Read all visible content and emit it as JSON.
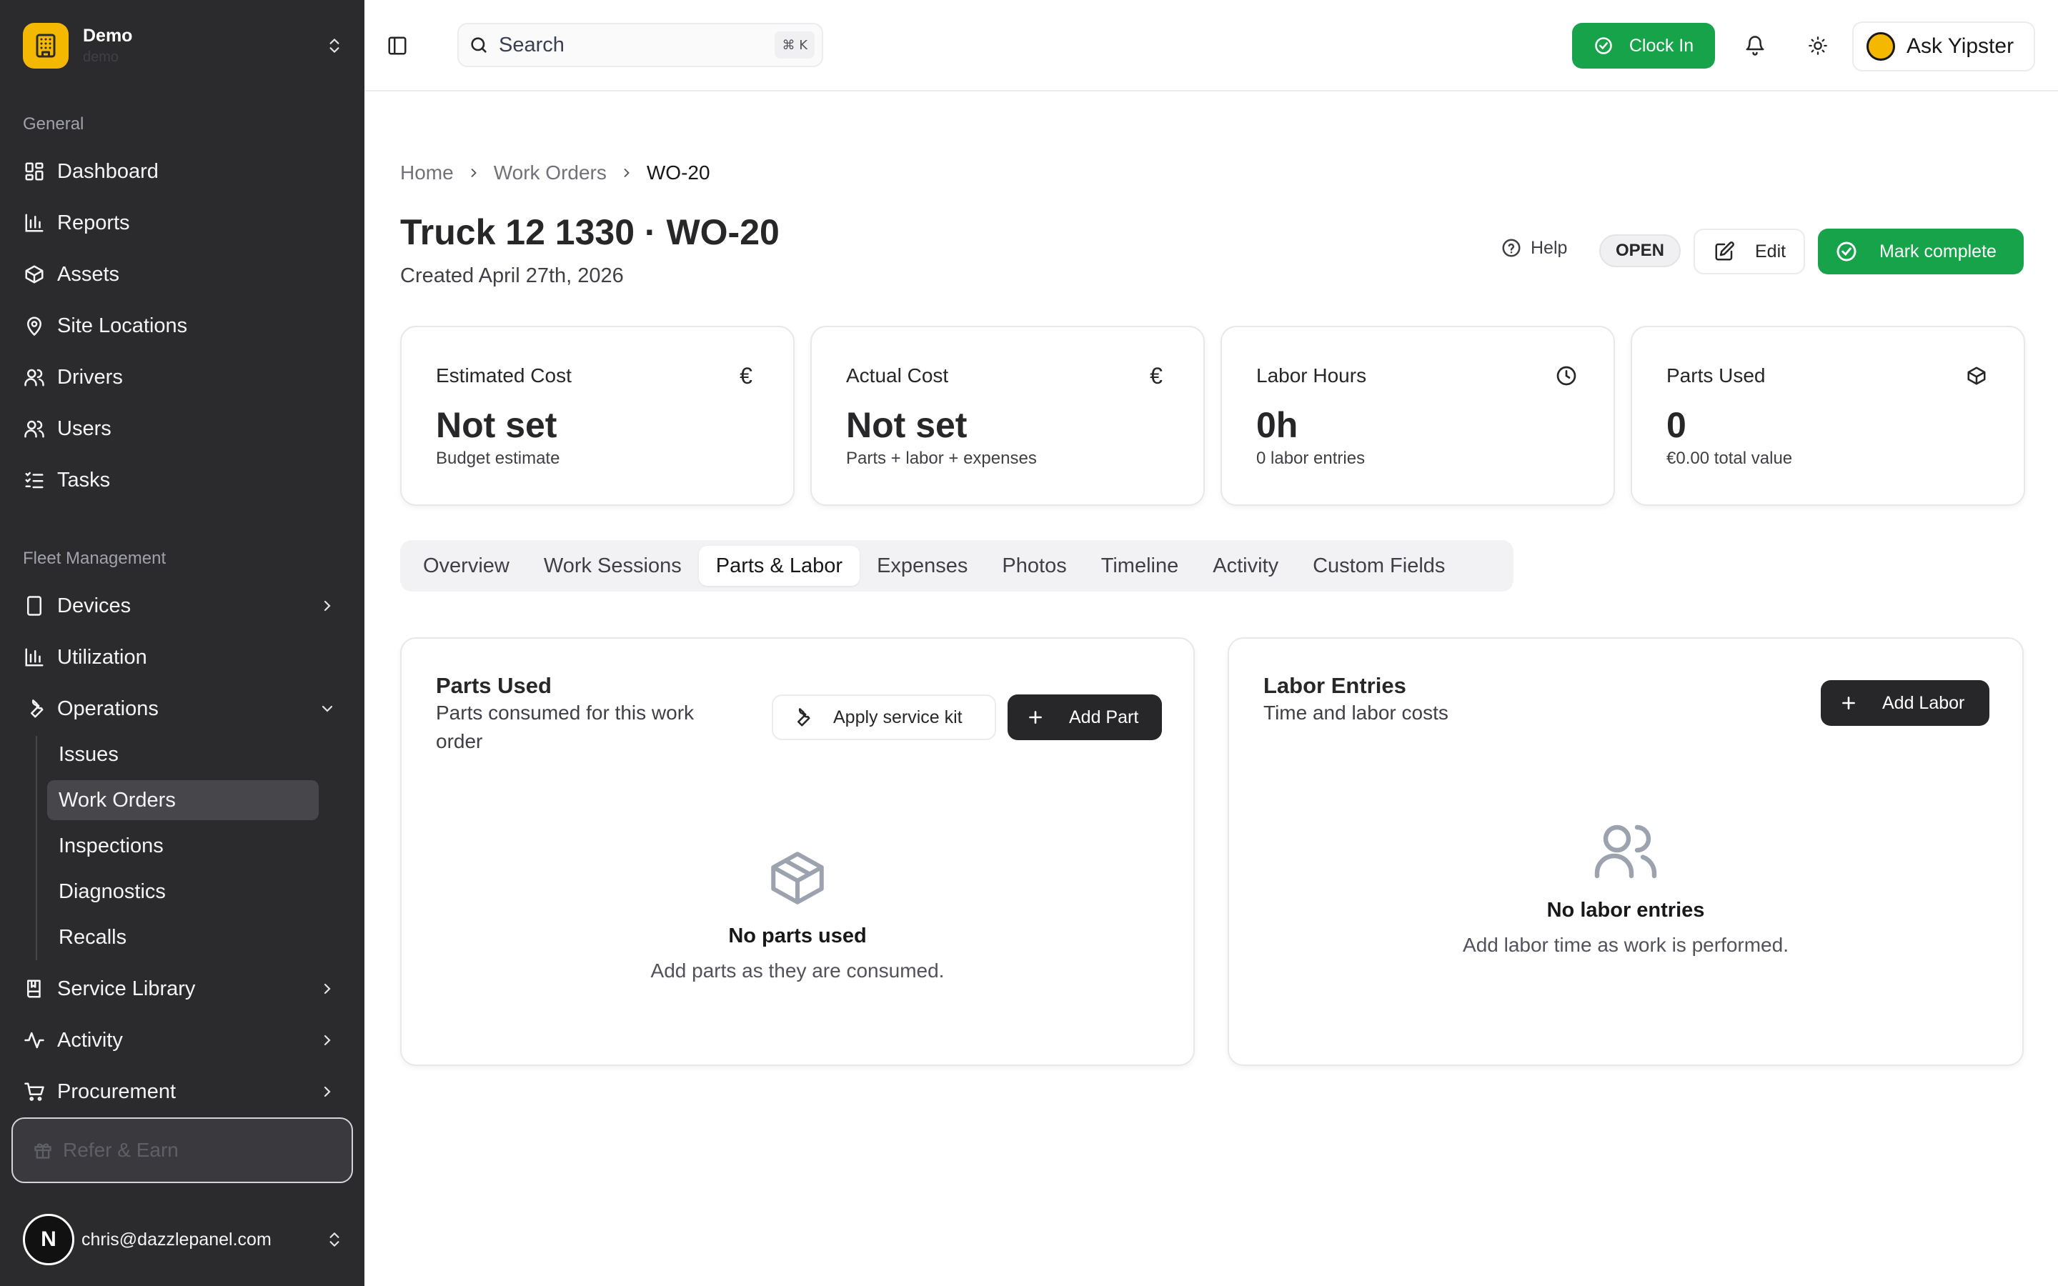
{
  "workspace": {
    "name": "Demo",
    "slug": "demo"
  },
  "sidebar": {
    "general_label": "General",
    "general_items": [
      {
        "label": "Dashboard",
        "icon": "dashboard-icon"
      },
      {
        "label": "Reports",
        "icon": "bar-chart-icon"
      },
      {
        "label": "Assets",
        "icon": "box-icon"
      },
      {
        "label": "Site Locations",
        "icon": "map-pin-icon"
      },
      {
        "label": "Drivers",
        "icon": "users-icon"
      },
      {
        "label": "Users",
        "icon": "users-icon"
      },
      {
        "label": "Tasks",
        "icon": "list-icon"
      }
    ],
    "fleet_label": "Fleet Management",
    "fleet_items": [
      {
        "label": "Devices",
        "icon": "tablet-icon"
      },
      {
        "label": "Utilization",
        "icon": "bar-chart-icon"
      },
      {
        "label": "Operations",
        "icon": "wrench-icon"
      }
    ],
    "operations_sub": [
      {
        "label": "Issues"
      },
      {
        "label": "Work Orders",
        "active": true
      },
      {
        "label": "Inspections"
      },
      {
        "label": "Diagnostics"
      },
      {
        "label": "Recalls"
      }
    ],
    "more_items": [
      {
        "label": "Service Library",
        "icon": "book-icon"
      },
      {
        "label": "Activity",
        "icon": "activity-icon"
      },
      {
        "label": "Procurement",
        "icon": "cart-icon"
      }
    ],
    "refer_label": "Refer & Earn",
    "user": {
      "initial": "N",
      "email": "chris@dazzlepanel.com"
    }
  },
  "topbar": {
    "search_placeholder": "Search",
    "search_shortcut": "⌘ K",
    "clock_in": "Clock In",
    "ask": "Ask Yipster"
  },
  "breadcrumb": [
    "Home",
    "Work Orders",
    "WO-20"
  ],
  "page": {
    "title": "Truck 12 1330 · WO-20",
    "created": "Created April 27th, 2026",
    "help": "Help",
    "status": "OPEN",
    "edit": "Edit",
    "mark_complete": "Mark complete"
  },
  "stats": [
    {
      "label": "Estimated Cost",
      "icon": "euro-icon",
      "value": "Not set",
      "sub": "Budget estimate"
    },
    {
      "label": "Actual Cost",
      "icon": "euro-icon",
      "value": "Not set",
      "sub": "Parts + labor + expenses"
    },
    {
      "label": "Labor Hours",
      "icon": "clock-icon",
      "value": "0h",
      "sub": "0 labor entries"
    },
    {
      "label": "Parts Used",
      "icon": "box-icon",
      "value": "0",
      "sub": "€0.00 total value"
    }
  ],
  "tabs": [
    {
      "label": "Overview"
    },
    {
      "label": "Work Sessions"
    },
    {
      "label": "Parts & Labor",
      "active": true
    },
    {
      "label": "Expenses"
    },
    {
      "label": "Photos"
    },
    {
      "label": "Timeline"
    },
    {
      "label": "Activity"
    },
    {
      "label": "Custom Fields"
    }
  ],
  "parts": {
    "title": "Parts Used",
    "desc_line1": "Parts consumed for this work",
    "desc_line2": "order",
    "apply_kit": "Apply service kit",
    "add_part": "Add Part",
    "empty_title": "No parts used",
    "empty_sub": "Add parts as they are consumed."
  },
  "labor": {
    "title": "Labor Entries",
    "desc": "Time and labor costs",
    "add_labor": "Add Labor",
    "empty_title": "No labor entries",
    "empty_sub": "Add labor time as work is performed."
  },
  "colors": {
    "sidebar_bg": "#2b2b2e",
    "accent_green": "#16a34a",
    "brand_yellow": "#f5b800",
    "dark_button": "#27272a"
  }
}
